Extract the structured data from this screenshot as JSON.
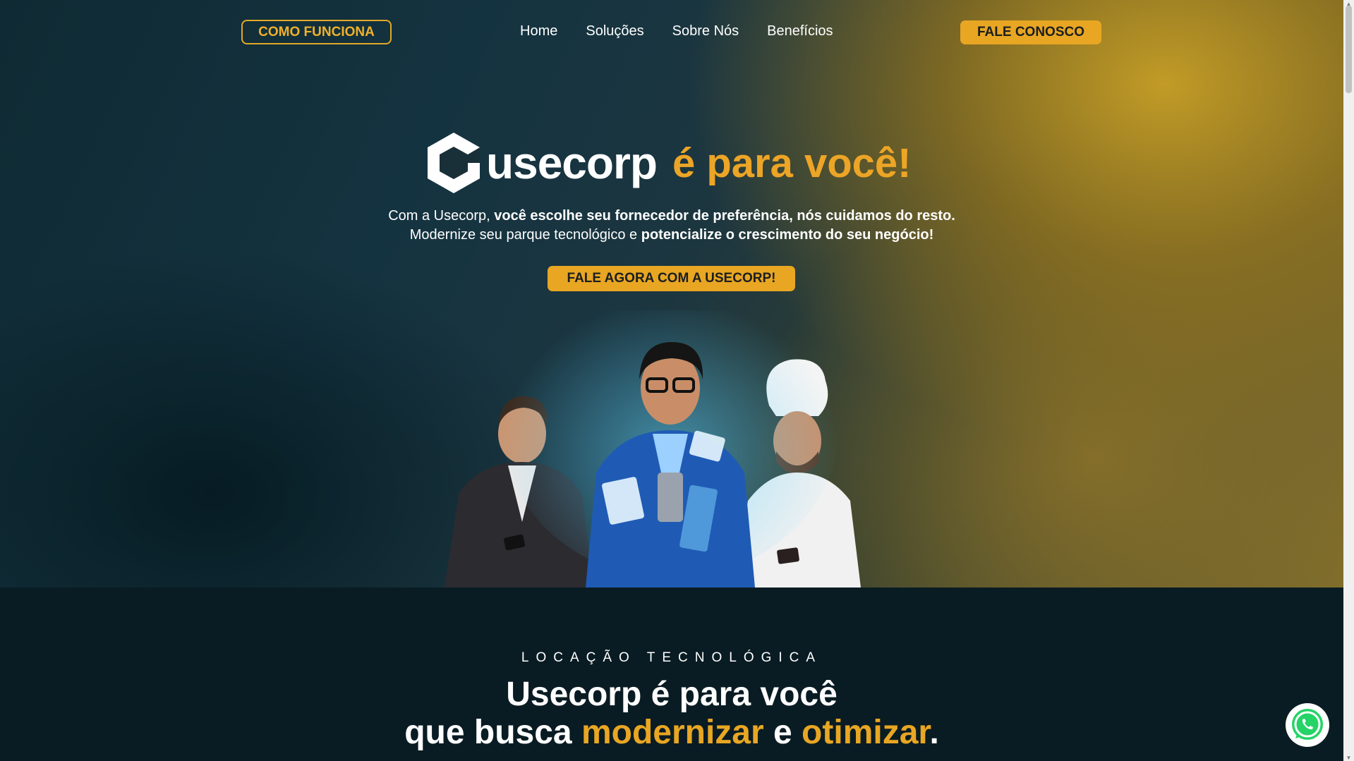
{
  "nav": {
    "how_it_works": "COMO FUNCIONA",
    "menu": [
      "Home",
      "Soluções",
      "Sobre Nós",
      "Benefícios"
    ],
    "contact": "FALE CONOSCO"
  },
  "hero": {
    "logo_text": "usecorp",
    "tagline": "é para você!",
    "line1_a": "Com a Usecorp, ",
    "line1_b": "você escolhe seu fornecedor de preferência, nós cuidamos do resto.",
    "line2_a": "Modernize seu parque tecnológico e ",
    "line2_b": "potencialize o crescimento do seu negócio!",
    "cta": "FALE AGORA COM A USECORP!"
  },
  "section2": {
    "eyebrow": "LOCAÇÃO TECNOLÓGICA",
    "h_line1": "Usecorp é para você",
    "h_a": "que busca ",
    "h_b": "modernizar",
    "h_c": " e ",
    "h_d": "otimizar",
    "h_e": "."
  },
  "colors": {
    "accent": "#e8a623",
    "dark_bg": "#0a1c23",
    "white": "#ffffff"
  },
  "icons": [
    "usecorp-logo-icon",
    "whatsapp-icon"
  ]
}
